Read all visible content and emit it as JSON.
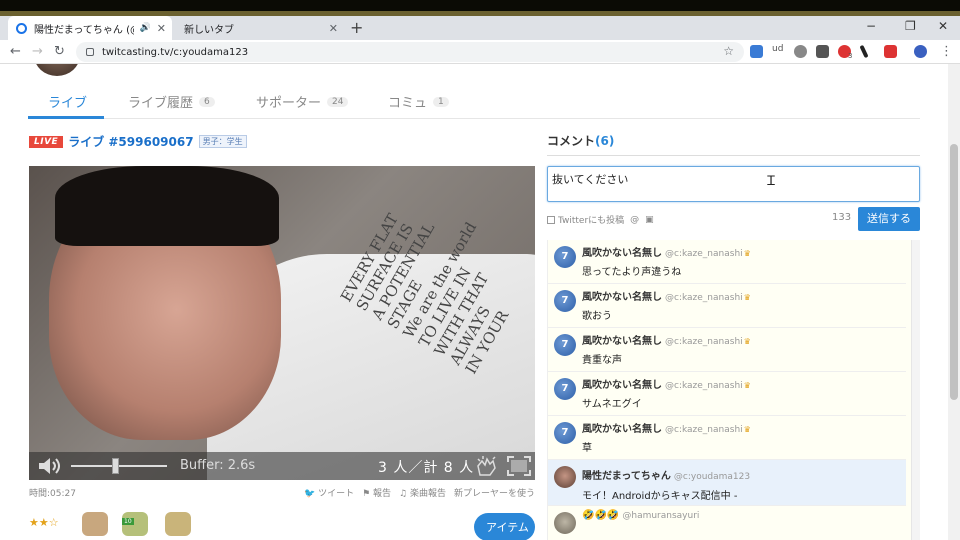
{
  "browser": {
    "tabs": [
      {
        "title": "陽性だまってちゃん (@c:youdan",
        "active": true
      },
      {
        "title": "新しいタブ",
        "active": false
      }
    ],
    "new_tab": "+",
    "controls": {
      "minimize": "−",
      "maximize": "❐",
      "close": "✕"
    },
    "url": "twitcasting.tv/c:youdama123",
    "extensions": [
      "ud",
      "3"
    ]
  },
  "nav": {
    "items": [
      {
        "label": "ライブ",
        "count": ""
      },
      {
        "label": "ライブ履歴",
        "count": "6"
      },
      {
        "label": "サポーター",
        "count": "24"
      },
      {
        "label": "コミュ",
        "count": "1"
      }
    ]
  },
  "live": {
    "badge": "LIVE",
    "title": "ライブ #599609067",
    "tag": "男子：学生"
  },
  "player": {
    "shirt_text": "EVERY FLAT\nSURFACE IS\nA POTENTIAL\nSTAGE\nWe are the world\nTO LIVE IN\nWITH THAT\nALWAYS\nIN YOUR",
    "buffer": "Buffer: 2.6s",
    "viewers": "3 人／計 8 人",
    "volume_level": 0.5
  },
  "under_video": {
    "time": "時間:05:27",
    "links": [
      "ツイート",
      "報告",
      "楽曲報告",
      "新プレーヤーを使う"
    ]
  },
  "rating": "★★☆",
  "gift_badge": "10",
  "item_button": "アイテム",
  "comments": {
    "header": "コメント",
    "count": "(6)",
    "input_value": "抜いてください",
    "twitter_option": "Twitterにも投稿",
    "char_count": "133",
    "send_label": "送信する",
    "list": [
      {
        "name": "風吹かない名無し",
        "id": "@c:kaze_nanashi",
        "text": "思ってたより声違うね",
        "self": false
      },
      {
        "name": "風吹かない名無し",
        "id": "@c:kaze_nanashi",
        "text": "歌おう",
        "self": false
      },
      {
        "name": "風吹かない名無し",
        "id": "@c:kaze_nanashi",
        "text": "貴重な声",
        "self": false
      },
      {
        "name": "風吹かない名無し",
        "id": "@c:kaze_nanashi",
        "text": "サムネエグイ",
        "self": false
      },
      {
        "name": "風吹かない名無し",
        "id": "@c:kaze_nanashi",
        "text": "草",
        "self": false
      },
      {
        "name": "陽性だまってちゃん",
        "id": "@c:youdama123",
        "text": "モイ！Androidからキャス配信中 -",
        "self": true
      },
      {
        "name": "🤣🤣🤣",
        "id": "@hamuransayuri",
        "text": "",
        "self": false
      }
    ]
  }
}
